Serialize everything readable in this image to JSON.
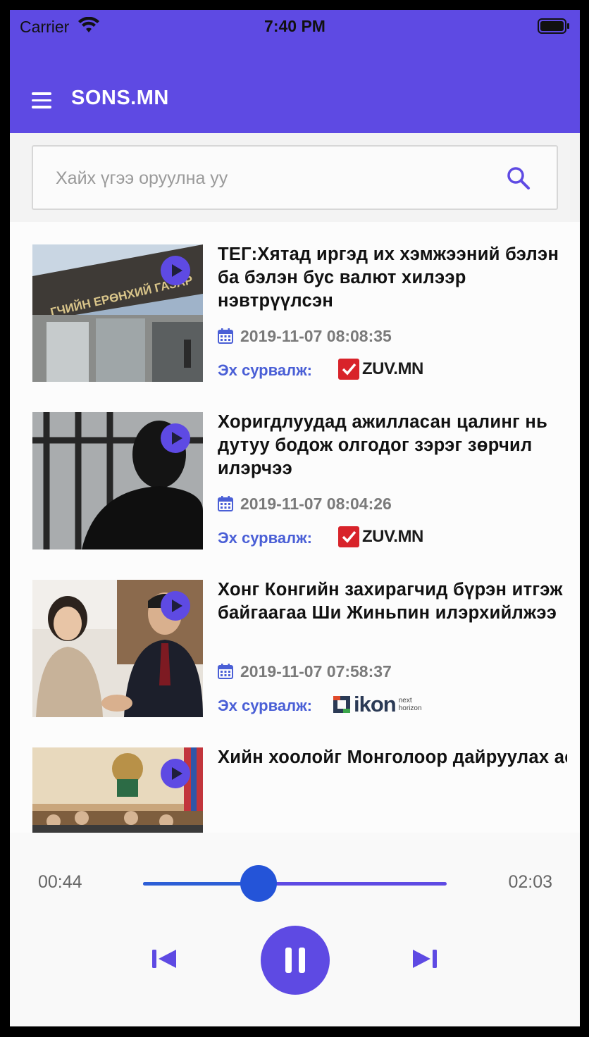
{
  "status_bar": {
    "carrier": "Carrier",
    "time": "7:40 PM"
  },
  "header": {
    "title": "SONS.MN"
  },
  "search": {
    "placeholder": "Хайх үгээ оруулна уу"
  },
  "source_label": "Эх сурвалж:",
  "news": [
    {
      "title": "ТЕГ:Хятад иргэд их хэмжээний бэлэн ба бэлэн бус валют хилээр нэвтрүүлсэн",
      "date": "2019-11-07 08:08:35",
      "source": "ZUV.MN"
    },
    {
      "title": "Хоригдлуудад ажилласан цалинг нь дутуу бодож олгодог зэрэг зөрчил илэрчээ",
      "date": "2019-11-07 08:04:26",
      "source": "ZUV.MN"
    },
    {
      "title": "Хонг Конгийн захирагчид бүрэн итгэж байгаагаа Ши Жиньпин илэрхийлжээ",
      "date": "2019-11-07 07:58:37",
      "source": "ikon",
      "source_sub": "next horizon"
    },
    {
      "title": "Хийн хоолойг Монголоор дайруулах асуудалд нухацтай хандаж, хамтран ажиллахыг хүсэв",
      "date": "",
      "source": ""
    }
  ],
  "player": {
    "current_time": "00:44",
    "total_time": "02:03",
    "progress": 0.38
  },
  "colors": {
    "primary": "#5e4ae3",
    "accent_blue": "#2454d8",
    "source_label": "#4a5fd6"
  }
}
